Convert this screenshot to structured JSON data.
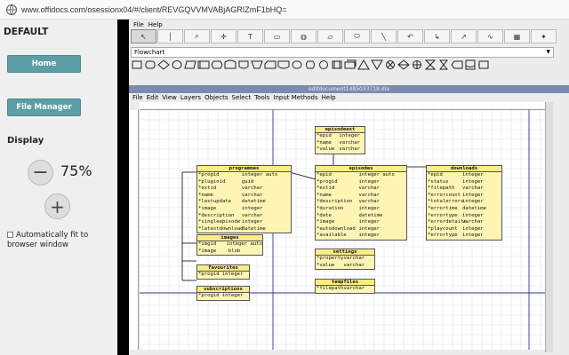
{
  "browser": {
    "url": "www.offidocs.com/osessionx04/#/client/REVGQVVMVABjAGRIZmF1bHQ="
  },
  "sidebar": {
    "title": "DEFAULT",
    "home_label": "Home",
    "file_manager_label": "File Manager",
    "display_label": "Display",
    "zoom_value": "75%",
    "autofit_label": "Automatically fit to browser window"
  },
  "dia": {
    "menu": [
      "File",
      "Help"
    ],
    "toolbar_icons": [
      "pointer-icon",
      "text-cursor-icon",
      "magnify-icon",
      "move-icon",
      "text-tool-icon",
      "box-icon",
      "ellipse-icon",
      "polygon-icon",
      "beziergon-icon",
      "line-icon",
      "arc-icon",
      "zigzag-icon",
      "polyline-icon",
      "bezier-icon",
      "image-icon",
      "outline-icon"
    ],
    "sheet": "Flowchart",
    "doc_title": "editdocument1485033718.dia",
    "doc_menu": [
      "File",
      "Edit",
      "View",
      "Layers",
      "Objects",
      "Select",
      "Tools",
      "Input Methods",
      "Help"
    ]
  },
  "tables": [
    {
      "name": "episodeext",
      "rows": [
        [
          "*epid",
          "integer"
        ],
        [
          "*name",
          "varchar"
        ],
        [
          "*value",
          "varchar"
        ]
      ]
    },
    {
      "name": "programmes",
      "rows": [
        [
          "*progid",
          "integer auto"
        ],
        [
          "*pluginid",
          "guid"
        ],
        [
          "*extid",
          "varchar"
        ],
        [
          "*name",
          "varchar"
        ],
        [
          "*lastupdate",
          "datetime"
        ],
        [
          "*image",
          "integer"
        ],
        [
          "*description",
          "varchar"
        ],
        [
          "*singleepisode",
          "integer"
        ],
        [
          "*latestdownload",
          "datetime"
        ]
      ]
    },
    {
      "name": "episodes",
      "rows": [
        [
          "*epid",
          "integer auto"
        ],
        [
          "*progid",
          "integer"
        ],
        [
          "*extid",
          "varchar"
        ],
        [
          "*name",
          "varchar"
        ],
        [
          "*description",
          "varchar"
        ],
        [
          "*duration",
          "integer"
        ],
        [
          "*date",
          "datetime"
        ],
        [
          "*image",
          "integer"
        ],
        [
          "*autodownload",
          "integer"
        ],
        [
          "*available",
          "integer"
        ]
      ]
    },
    {
      "name": "downloads",
      "rows": [
        [
          "*epid",
          "integer"
        ],
        [
          "*status",
          "integer"
        ],
        [
          "*filepath",
          "varchar"
        ],
        [
          "*errorcount",
          "integer"
        ],
        [
          "*totalerrors",
          "integer"
        ],
        [
          "*errortime",
          "datetime"
        ],
        [
          "*errortype",
          "integer"
        ],
        [
          "*errordetails",
          "varchar"
        ],
        [
          "*playcount",
          "integer"
        ],
        [
          "*errortype",
          "integer"
        ]
      ]
    },
    {
      "name": "images",
      "rows": [
        [
          "*imgid",
          "integer auto"
        ],
        [
          "*image",
          "blob"
        ]
      ]
    },
    {
      "name": "settings",
      "rows": [
        [
          "*property",
          "varchar"
        ],
        [
          "*value",
          "varchar"
        ]
      ]
    },
    {
      "name": "favourites",
      "rows": [
        [
          "*progid",
          "integer"
        ]
      ]
    },
    {
      "name": "tempfiles",
      "rows": [
        [
          "*filepath",
          "varchar"
        ]
      ]
    },
    {
      "name": "subscriptions",
      "rows": [
        [
          "*progid",
          "integer"
        ]
      ]
    }
  ]
}
